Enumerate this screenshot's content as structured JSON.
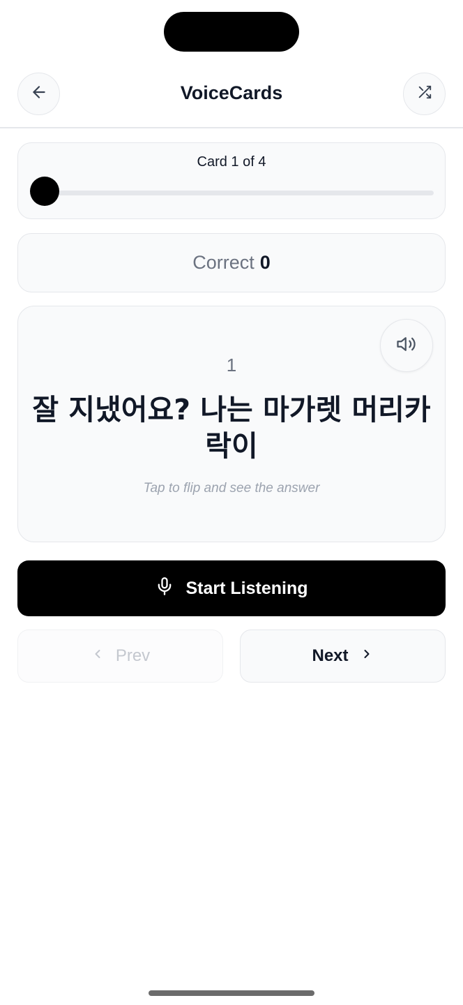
{
  "app": {
    "title": "VoiceCards"
  },
  "header": {
    "back_icon": "arrow-left-icon",
    "shuffle_icon": "shuffle-icon"
  },
  "progress": {
    "label": "Card 1 of 4",
    "current": 1,
    "total": 4,
    "slider_fraction": 0.0
  },
  "score": {
    "label": "Correct",
    "value": "0"
  },
  "card": {
    "number": "1",
    "text": "잘 지냈어요? 나는 마가렛 머리카락이",
    "hint": "Tap to flip and see the answer",
    "speaker_icon": "speaker-icon"
  },
  "actions": {
    "listen_label": "Start Listening",
    "listen_icon": "microphone-icon",
    "prev_label": "Prev",
    "next_label": "Next",
    "prev_disabled": true
  },
  "colors": {
    "primary": "#000000",
    "surface": "#f9fafb",
    "border": "#e5e7eb",
    "muted_text": "#6b7280",
    "hint_text": "#9ca3af",
    "disabled_text": "#c4c8cf"
  }
}
